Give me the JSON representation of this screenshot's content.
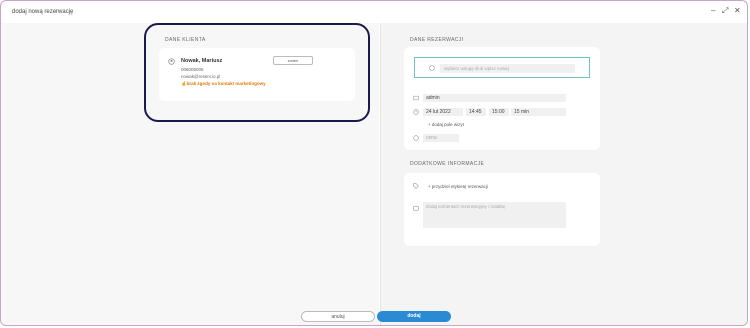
{
  "window": {
    "title": "dodaj nową rezerwację",
    "minimize": "–",
    "restore": "⤢",
    "close": "✕"
  },
  "client": {
    "section_label": "DANE KLIENTA",
    "name": "Nowak, Mariusz",
    "phone": "006005006",
    "email": "nowak@reserv.io.pl",
    "consent": "brak zgody na kontakt marketingowy",
    "change_label": "zmień"
  },
  "reservation": {
    "section_label": "DANE REZERWACJI",
    "service_placeholder": "wybierz usługę i/lub wpisz nowej",
    "employee": "admin",
    "date": "24 lut 2022",
    "time_start": "14:45",
    "time_end": "15:00",
    "duration": "15 min",
    "add_visit_field": "dodaj pole wizyt",
    "price_placeholder": "cena"
  },
  "additional": {
    "section_label": "DODATKOWE INFORMACJE",
    "add_tag": "przydziel etykietę rezerwacji",
    "comment_placeholder": "dodaj komentarz rezerwacyjny / notatkę"
  },
  "footer": {
    "cancel_label": "anuluj",
    "add_label": "dodaj"
  },
  "colors": {
    "accent": "#2a8ad4",
    "highlight": "#1a1a4e",
    "consent": "#e07b00",
    "service_border": "#73c2c2"
  }
}
